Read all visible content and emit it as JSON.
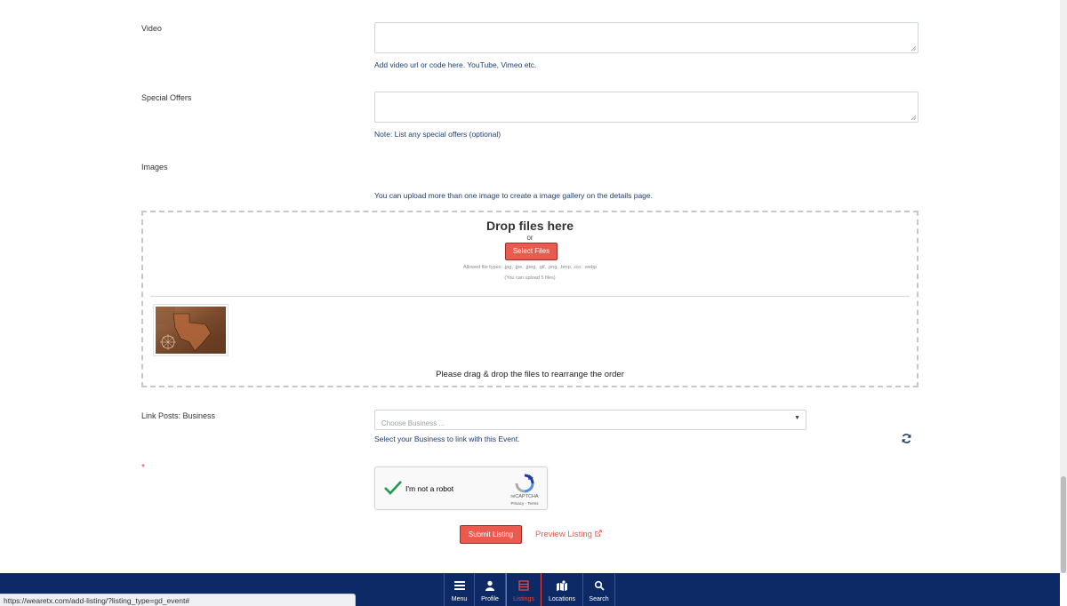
{
  "form": {
    "video": {
      "label": "Video",
      "help": "Add video url or code here. YouTube, Vimeo etc.",
      "value": ""
    },
    "special_offers": {
      "label": "Special Offers",
      "help": "Note: List any special offers (optional)",
      "value": ""
    },
    "images": {
      "label": "Images",
      "help": "You can upload more than one image to create a image gallery on the details page.",
      "drop_title": "Drop files here",
      "or_text": "or",
      "select_button": "Select Files",
      "allowed_types": "Allowed file types: .jpg, .jpe, .jpeg, .gif, .png, .bmp, .ico, .webp",
      "limit_text": "(You can upload 5 files)",
      "reorder_hint": "Please drag & drop the files to rearrange the order"
    },
    "link_posts": {
      "label": "Link Posts: Business",
      "placeholder": "Choose Business ...",
      "help": "Select your Business to link with this Event."
    },
    "required_marker": "*",
    "captcha": {
      "label": "I'm not a robot",
      "brand": "reCAPTCHA",
      "terms": "Privacy - Terms",
      "checked": true
    },
    "submit_label": "Submit Listing",
    "preview_label": "Preview Listing"
  },
  "bottom_nav": {
    "items": [
      {
        "label": "Menu",
        "icon": "menu-icon"
      },
      {
        "label": "Profile",
        "icon": "user-icon"
      },
      {
        "label": "Listings",
        "icon": "listings-icon",
        "active": true
      },
      {
        "label": "Locations",
        "icon": "map-icon"
      },
      {
        "label": "Search",
        "icon": "search-icon"
      }
    ]
  },
  "status_bar": {
    "url": "https://wearetx.com/add-listing/?listing_type=gd_event#"
  },
  "colors": {
    "accent": "#ea5a4f",
    "nav_bg": "#0d2a66",
    "help_text": "#1c3d6b",
    "active_nav": "#e24a3f"
  }
}
